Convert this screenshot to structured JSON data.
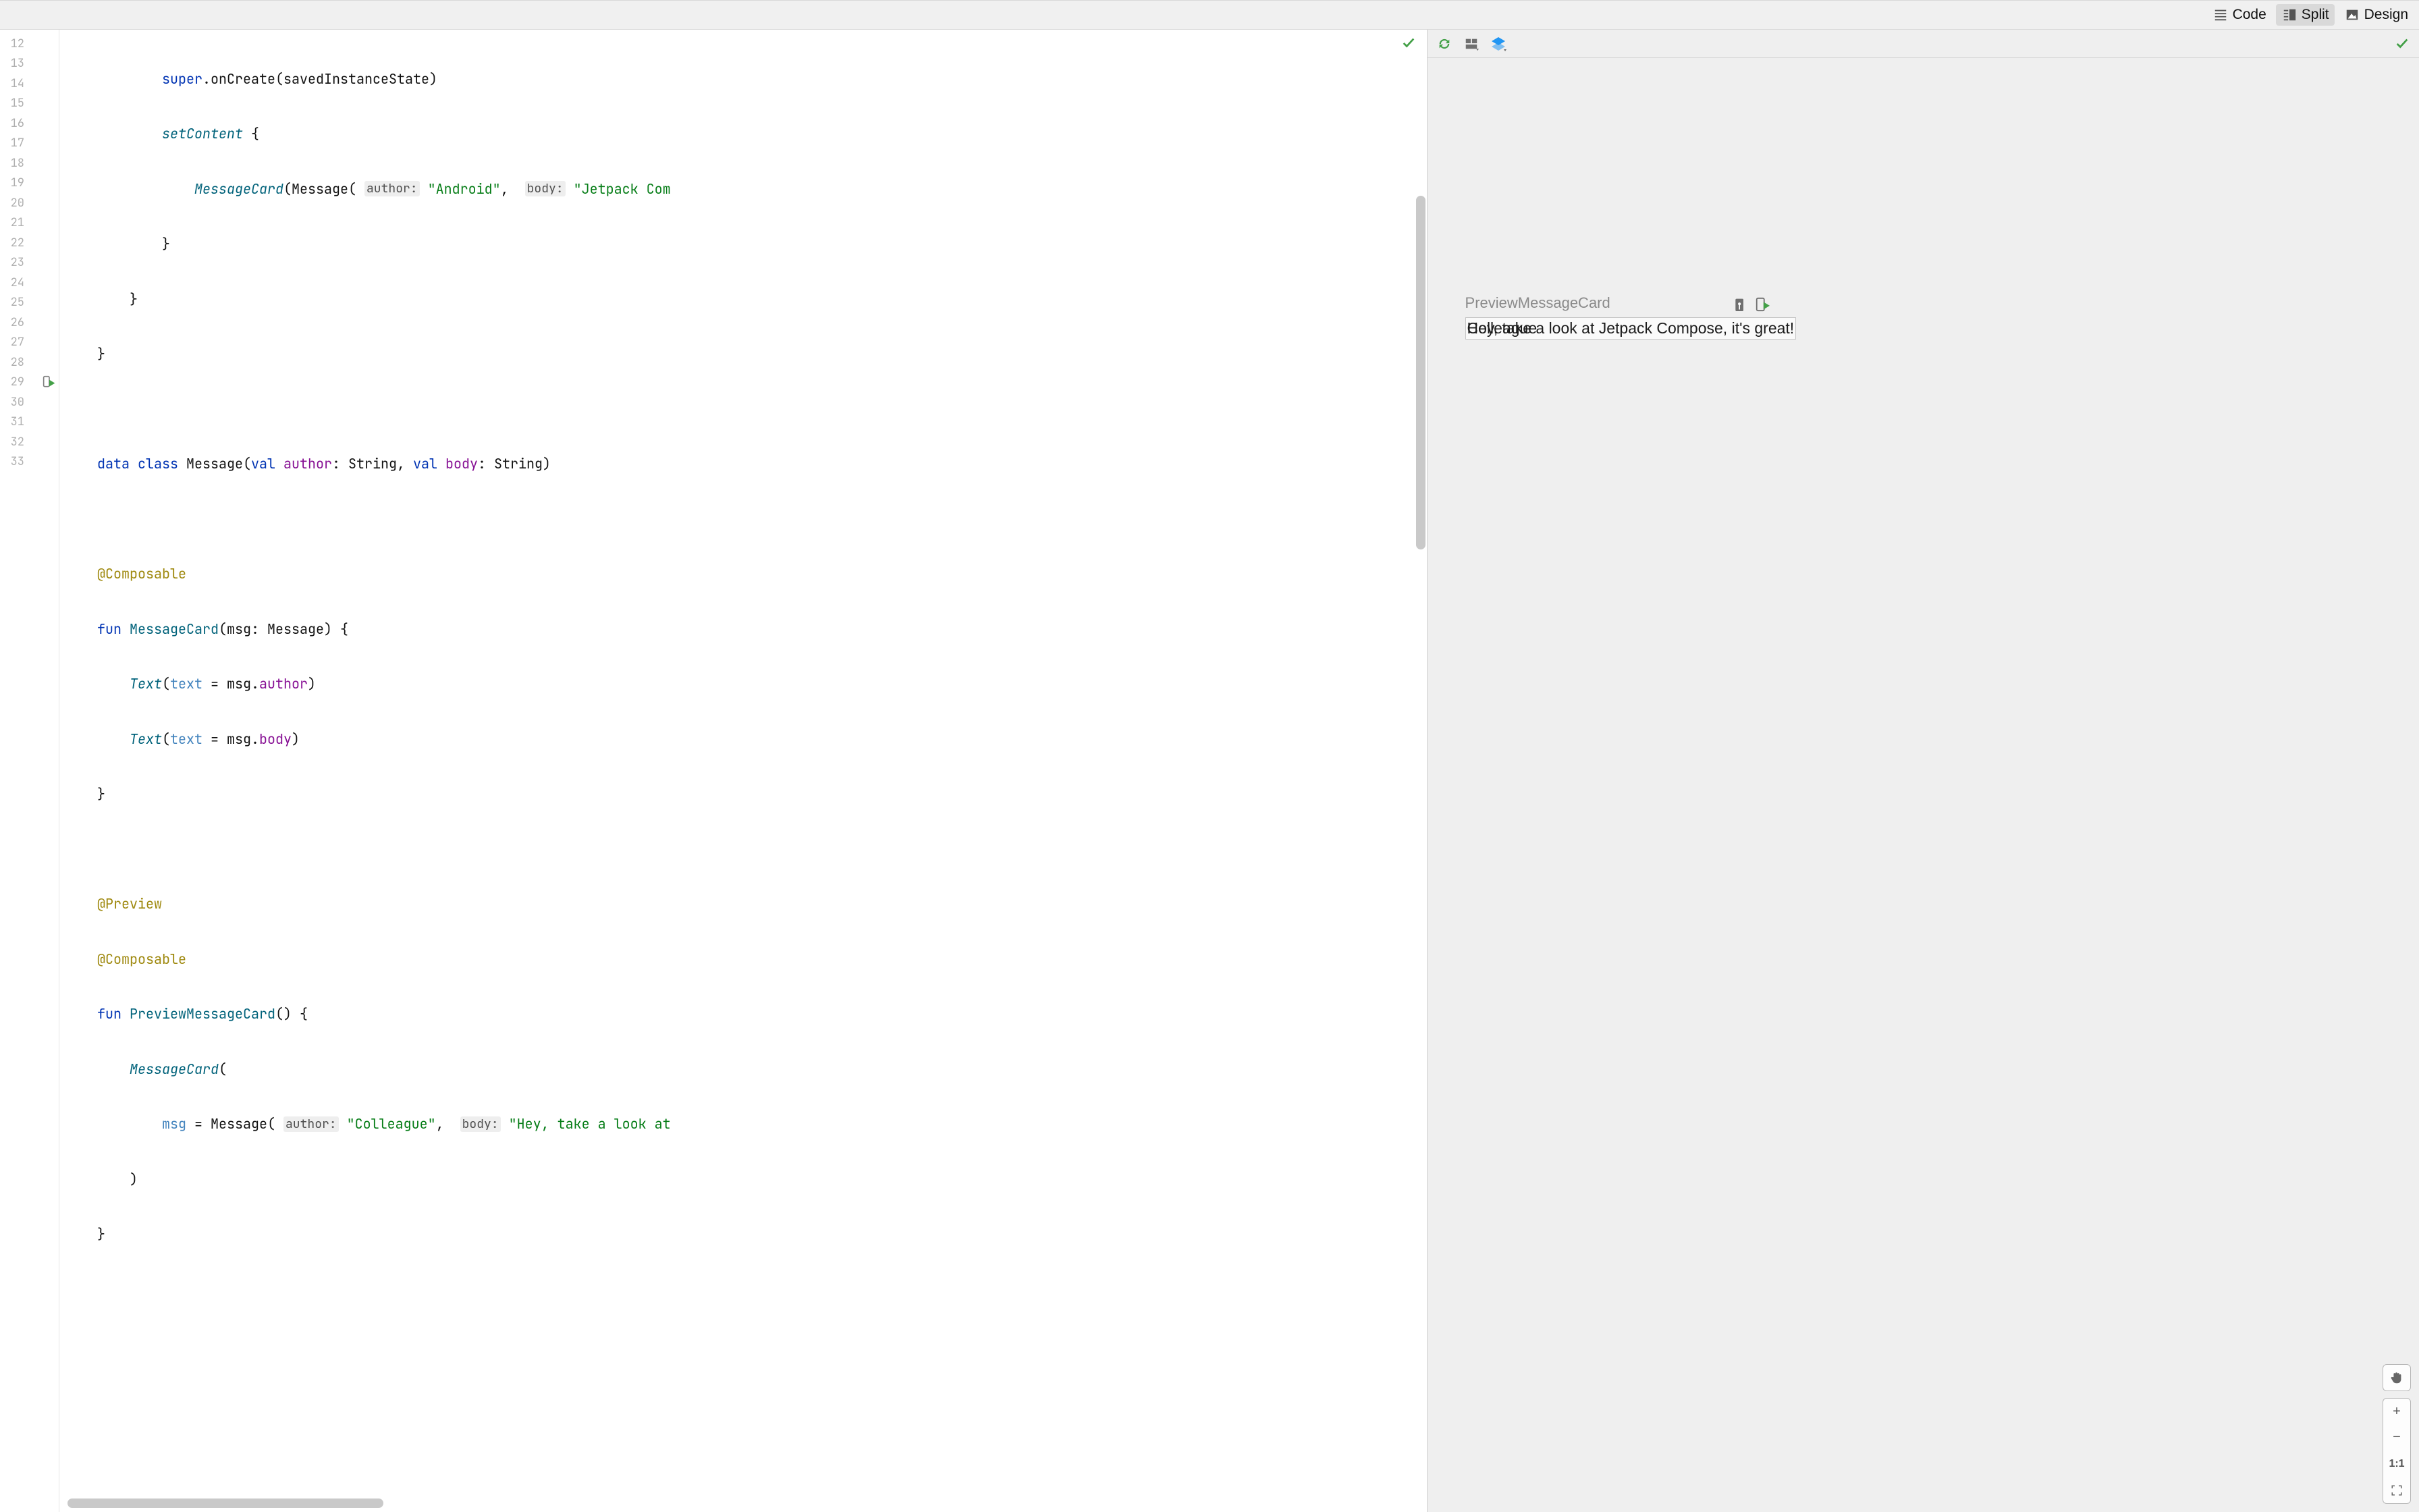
{
  "toolbar": {
    "code_label": "Code",
    "split_label": "Split",
    "design_label": "Design",
    "active": "Split"
  },
  "editor": {
    "line_start": 12,
    "lines": [
      "            super.onCreate(savedInstanceState)",
      "            setContent {",
      "                MessageCard(Message( author: \"Android\",  body: \"Jetpack Com",
      "            }",
      "        }",
      "    }",
      "",
      "    data class Message(val author: String, val body: String)",
      "",
      "    @Composable",
      "    fun MessageCard(msg: Message) {",
      "        Text(text = msg.author)",
      "        Text(text = msg.body)",
      "    }",
      "",
      "    @Preview",
      "    @Composable",
      "    fun PreviewMessageCard() {",
      "        MessageCard(",
      "            msg = Message( author: \"Colleague\",  body: \"Hey, take a look at",
      "        )",
      "    }"
    ],
    "run_gutter_line": 29
  },
  "preview": {
    "title": "PreviewMessageCard",
    "author_text": "Colleague",
    "body_text": "Hey, take a look at Jetpack Compose, it's great!"
  },
  "zoom": {
    "pan": "✋",
    "plus": "+",
    "minus": "−",
    "one_to_one": "1:1",
    "fit": "⛶"
  }
}
